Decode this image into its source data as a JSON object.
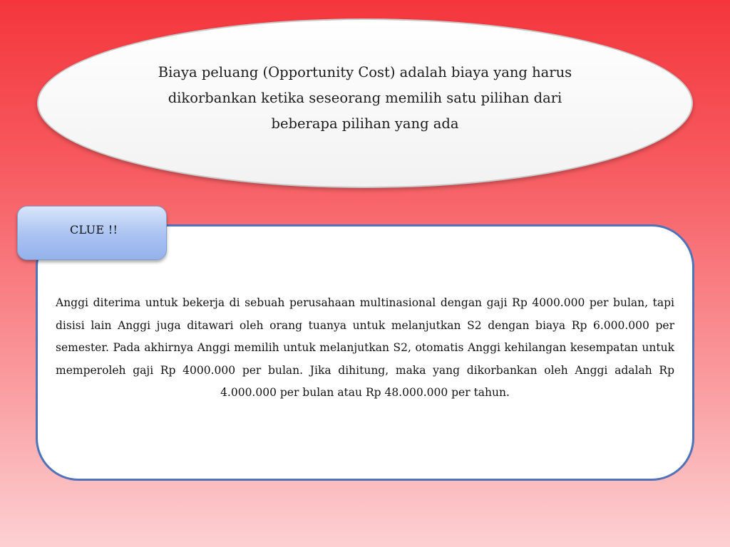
{
  "definition": {
    "text": "Biaya peluang (Opportunity Cost) adalah biaya yang harus dikorbankan ketika seseorang memilih satu pilihan dari beberapa pilihan yang ada"
  },
  "clue": {
    "label": "CLUE !!"
  },
  "example": {
    "text": "Anggi diterima untuk bekerja di sebuah perusahaan multinasional dengan gaji Rp 4000.000 per bulan, tapi disisi lain Anggi juga ditawari oleh orang tuanya untuk melanjutkan S2 dengan biaya Rp 6.000.000 per semester. Pada akhirnya Anggi memilih untuk melanjutkan S2, otomatis Anggi kehilangan kesempatan untuk memperoleh gaji Rp 4000.000 per bulan. Jika dihitung, maka yang dikorbankan oleh Anggi adalah Rp 4.000.000 per bulan atau Rp 48.000.000 per tahun."
  },
  "colors": {
    "background_top": "#f4363c",
    "background_bottom": "#fcd0d2",
    "box_border": "#4f72b8",
    "clue_tab": "#a9c2f1"
  }
}
